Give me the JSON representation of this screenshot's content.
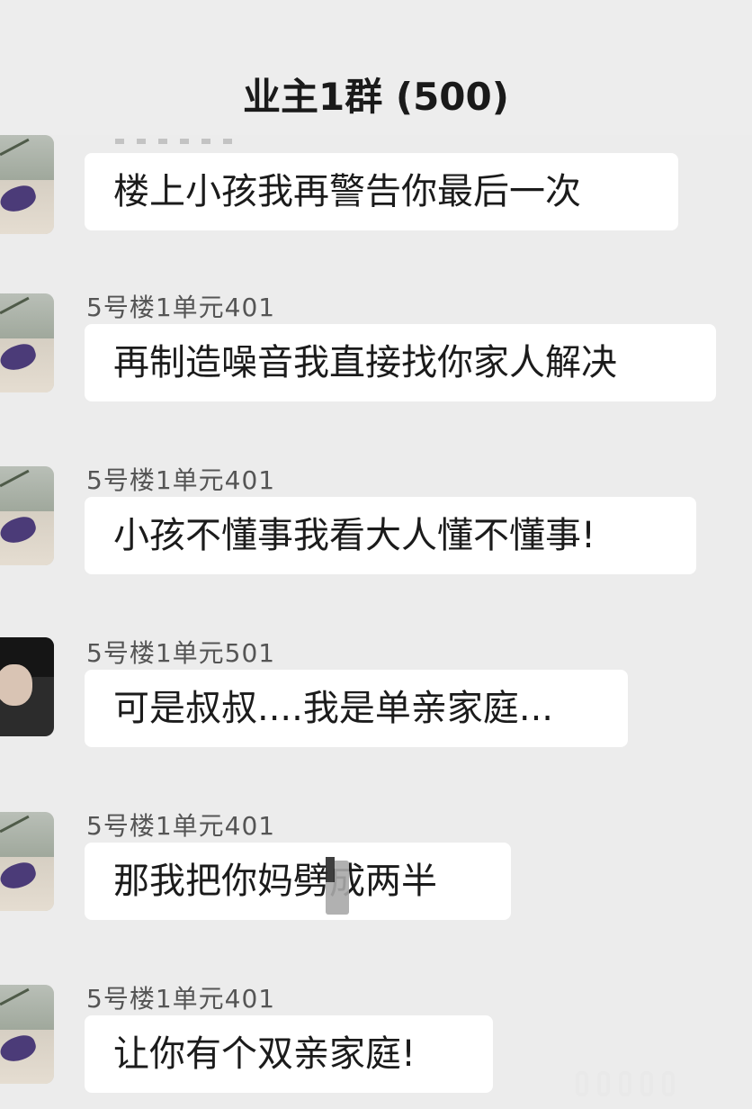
{
  "header": {
    "title": "业主1群 (500)"
  },
  "messages": [
    {
      "sender": "",
      "text": "楼上小孩我再警告你最后一次",
      "avatar": "park-photo-avatar"
    },
    {
      "sender": "5号楼1单元401",
      "text": "再制造噪音我直接找你家人解决",
      "avatar": "park-photo-avatar"
    },
    {
      "sender": "5号楼1单元401",
      "text": "小孩不懂事我看大人懂不懂事!",
      "avatar": "park-photo-avatar"
    },
    {
      "sender": "5号楼1单元501",
      "text": "可是叔叔....我是单亲家庭...",
      "avatar": "person-photo-avatar"
    },
    {
      "sender": "5号楼1单元401",
      "text": "那我把你妈劈成两半",
      "avatar": "park-photo-avatar"
    },
    {
      "sender": "5号楼1单元401",
      "text": "让你有个双亲家庭!",
      "avatar": "park-photo-avatar"
    }
  ],
  "colors": {
    "background": "#ececec",
    "bubble": "#ffffff",
    "sender_text": "#555555",
    "message_text": "#1b1b1b"
  }
}
